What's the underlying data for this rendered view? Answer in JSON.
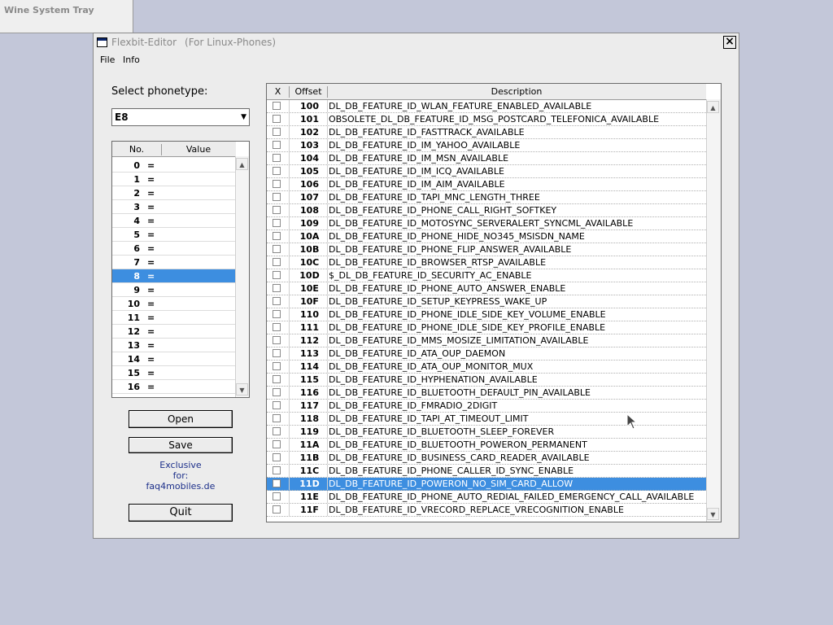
{
  "tray": {
    "title": "Wine System Tray"
  },
  "window": {
    "title": "Flexbit-Editor",
    "subtitle": "(For Linux-Phones)",
    "close": "×"
  },
  "menu": {
    "file": "File",
    "info": "Info"
  },
  "phonetype": {
    "label": "Select phonetype:",
    "value": "E8"
  },
  "numlist": {
    "headers": {
      "no": "No.",
      "value": "Value"
    },
    "rows": [
      {
        "no": "0",
        "eq": "="
      },
      {
        "no": "1",
        "eq": "="
      },
      {
        "no": "2",
        "eq": "="
      },
      {
        "no": "3",
        "eq": "="
      },
      {
        "no": "4",
        "eq": "="
      },
      {
        "no": "5",
        "eq": "="
      },
      {
        "no": "6",
        "eq": "="
      },
      {
        "no": "7",
        "eq": "="
      },
      {
        "no": "8",
        "eq": "="
      },
      {
        "no": "9",
        "eq": "="
      },
      {
        "no": "10",
        "eq": "="
      },
      {
        "no": "11",
        "eq": "="
      },
      {
        "no": "12",
        "eq": "="
      },
      {
        "no": "13",
        "eq": "="
      },
      {
        "no": "14",
        "eq": "="
      },
      {
        "no": "15",
        "eq": "="
      },
      {
        "no": "16",
        "eq": "="
      }
    ],
    "selected_index": 8
  },
  "buttons": {
    "open": "Open",
    "save": "Save",
    "quit": "Quit"
  },
  "exclusive": {
    "line1": "Exclusive",
    "line2": "for:",
    "line3": "faq4mobiles.de"
  },
  "grid": {
    "headers": {
      "x": "X",
      "offset": "Offset",
      "description": "Description"
    },
    "rows": [
      {
        "offset": "100",
        "desc": "DL_DB_FEATURE_ID_WLAN_FEATURE_ENABLED_AVAILABLE"
      },
      {
        "offset": "101",
        "desc": "OBSOLETE_DL_DB_FEATURE_ID_MSG_POSTCARD_TELEFONICA_AVAILABLE"
      },
      {
        "offset": "102",
        "desc": "DL_DB_FEATURE_ID_FASTTRACK_AVAILABLE"
      },
      {
        "offset": "103",
        "desc": "DL_DB_FEATURE_ID_IM_YAHOO_AVAILABLE"
      },
      {
        "offset": "104",
        "desc": "DL_DB_FEATURE_ID_IM_MSN_AVAILABLE"
      },
      {
        "offset": "105",
        "desc": "DL_DB_FEATURE_ID_IM_ICQ_AVAILABLE"
      },
      {
        "offset": "106",
        "desc": "DL_DB_FEATURE_ID_IM_AIM_AVAILABLE"
      },
      {
        "offset": "107",
        "desc": "DL_DB_FEATURE_ID_TAPI_MNC_LENGTH_THREE"
      },
      {
        "offset": "108",
        "desc": "DL_DB_FEATURE_ID_PHONE_CALL_RIGHT_SOFTKEY"
      },
      {
        "offset": "109",
        "desc": "DL_DB_FEATURE_ID_MOTOSYNC_SERVERALERT_SYNCML_AVAILABLE"
      },
      {
        "offset": "10A",
        "desc": "DL_DB_FEATURE_ID_PHONE_HIDE_NO345_MSISDN_NAME"
      },
      {
        "offset": "10B",
        "desc": "DL_DB_FEATURE_ID_PHONE_FLIP_ANSWER_AVAILABLE"
      },
      {
        "offset": "10C",
        "desc": "DL_DB_FEATURE_ID_BROWSER_RTSP_AVAILABLE"
      },
      {
        "offset": "10D",
        "desc": "$_DL_DB_FEATURE_ID_SECURITY_AC_ENABLE"
      },
      {
        "offset": "10E",
        "desc": "DL_DB_FEATURE_ID_PHONE_AUTO_ANSWER_ENABLE"
      },
      {
        "offset": "10F",
        "desc": "DL_DB_FEATURE_ID_SETUP_KEYPRESS_WAKE_UP"
      },
      {
        "offset": "110",
        "desc": "DL_DB_FEATURE_ID_PHONE_IDLE_SIDE_KEY_VOLUME_ENABLE"
      },
      {
        "offset": "111",
        "desc": "DL_DB_FEATURE_ID_PHONE_IDLE_SIDE_KEY_PROFILE_ENABLE"
      },
      {
        "offset": "112",
        "desc": "DL_DB_FEATURE_ID_MMS_MOSIZE_LIMITATION_AVAILABLE"
      },
      {
        "offset": "113",
        "desc": "DL_DB_FEATURE_ID_ATA_OUP_DAEMON"
      },
      {
        "offset": "114",
        "desc": "DL_DB_FEATURE_ID_ATA_OUP_MONITOR_MUX"
      },
      {
        "offset": "115",
        "desc": "DL_DB_FEATURE_ID_HYPHENATION_AVAILABLE"
      },
      {
        "offset": "116",
        "desc": "DL_DB_FEATURE_ID_BLUETOOTH_DEFAULT_PIN_AVAILABLE"
      },
      {
        "offset": "117",
        "desc": "DL_DB_FEATURE_ID_FMRADIO_2DIGIT"
      },
      {
        "offset": "118",
        "desc": "DL_DB_FEATURE_ID_TAPI_AT_TIMEOUT_LIMIT"
      },
      {
        "offset": "119",
        "desc": "DL_DB_FEATURE_ID_BLUETOOTH_SLEEP_FOREVER"
      },
      {
        "offset": "11A",
        "desc": "DL_DB_FEATURE_ID_BLUETOOTH_POWERON_PERMANENT"
      },
      {
        "offset": "11B",
        "desc": "DL_DB_FEATURE_ID_BUSINESS_CARD_READER_AVAILABLE"
      },
      {
        "offset": "11C",
        "desc": "DL_DB_FEATURE_ID_PHONE_CALLER_ID_SYNC_ENABLE"
      },
      {
        "offset": "11D",
        "desc": "DL_DB_FEATURE_ID_POWERON_NO_SIM_CARD_ALLOW"
      },
      {
        "offset": "11E",
        "desc": "DL_DB_FEATURE_ID_PHONE_AUTO_REDIAL_FAILED_EMERGENCY_CALL_AVAILABLE"
      },
      {
        "offset": "11F",
        "desc": "DL_DB_FEATURE_ID_VRECORD_REPLACE_VRECOGNITION_ENABLE"
      }
    ],
    "selected_index": 29
  },
  "colors": {
    "selection": "#3d8ee0",
    "desktop": "#c3c7d9",
    "window": "#ececec"
  }
}
